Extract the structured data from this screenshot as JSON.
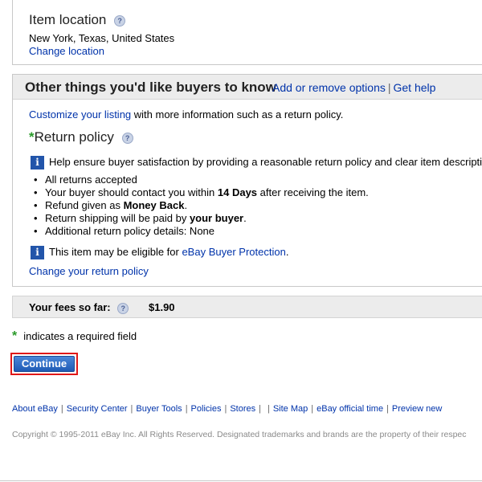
{
  "item_location": {
    "title": "Item location",
    "value": "New York, Texas, United States",
    "change_link": "Change location"
  },
  "other_section": {
    "title": "Other things you'd like buyers to know",
    "add_remove_link": "Add or remove options",
    "separator": "|",
    "get_help_link": "Get help",
    "customize_link": "Customize your listing",
    "customize_rest": " with more information such as a return policy.",
    "return_policy_title": "Return policy",
    "info_text": "Help ensure buyer satisfaction by providing a reasonable return policy and clear item descripti",
    "bullets": {
      "b1": "All returns accepted",
      "b2_pre": "Your buyer should contact you within ",
      "b2_bold": "14 Days",
      "b2_post": " after receiving the item.",
      "b3_pre": "Refund given as ",
      "b3_bold": "Money Back",
      "b3_post": ".",
      "b4_pre": "Return shipping will be paid by ",
      "b4_bold": "your buyer",
      "b4_post": ".",
      "b5": "Additional return policy details: None"
    },
    "protection_pre": "This item may be eligible for ",
    "protection_link": "eBay Buyer Protection",
    "protection_post": ".",
    "change_return_link": "Change your return policy"
  },
  "fees": {
    "label": "Your fees so far:",
    "value": "$1.90"
  },
  "required_note": {
    "star": "*",
    "text": "indicates a required field"
  },
  "continue_button": "Continue",
  "footer": {
    "links": [
      "About eBay",
      "Security Center",
      "Buyer Tools",
      "Policies",
      "Stores",
      "",
      "Site Map",
      "eBay official time",
      "Preview new"
    ],
    "separator": "|",
    "copyright": "Copyright © 1995-2011 eBay Inc. All Rights Reserved. Designated trademarks and brands are the property of their respec"
  },
  "icons": {
    "help": "question-help-icon",
    "info": "info-icon"
  },
  "colors": {
    "link": "#0033aa",
    "required_star": "#2a9a2a",
    "button_outline": "#e01818",
    "info_icon_bg": "#2255aa"
  }
}
